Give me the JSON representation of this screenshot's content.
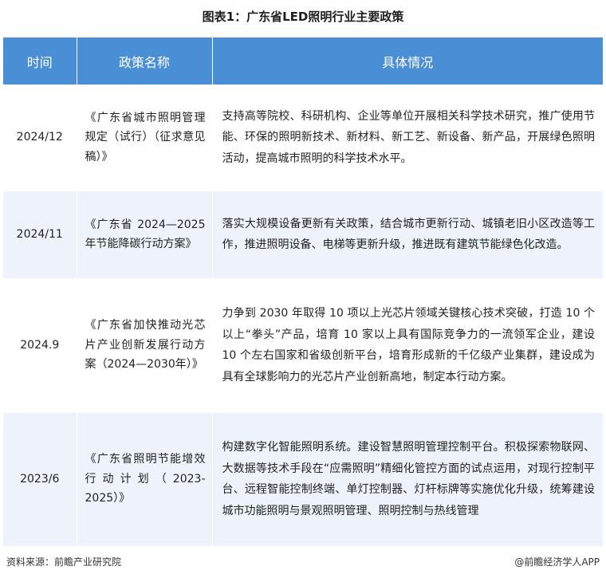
{
  "title": "图表1：广东省LED照明行业主要政策",
  "headers": [
    "时间",
    "政策名称",
    "具体情况"
  ],
  "rows": [
    {
      "time": "2024/12",
      "name": "《广东省城市照明管理规定（试行）（征求意见稿）》",
      "detail": "支持高等院校、科研机构、企业等单位开展相关科学技术研究，推广使用节能、环保的照明新技术、新材料、新工艺、新设备、新产品，开展绿色照明活动，提高城市照明的科学技术水平。"
    },
    {
      "time": "2024/11",
      "name": "《广东省 2024—2025 年节能降碳行动方案》",
      "detail": "落实大规模设备更新有关政策，结合城市更新行动、城镇老旧小区改造等工作，推进照明设备、电梯等更新升级，推进既有建筑节能绿色化改造。"
    },
    {
      "time": "2024.9",
      "name": "《广东省加快推动光芯片产业创新发展行动方案（2024—2030年）》",
      "detail": "力争到 2030 年取得 10 项以上光芯片领域关键核心技术突破，打造 10 个以上“拳头”产品，培育 10 家以上具有国际竞争力的一流领军企业，建设 10 个左右国家和省级创新平台，培育形成新的千亿级产业集群，建设成为具有全球影响力的光芯片产业创新高地，制定本行动方案。"
    },
    {
      "time": "2023/6",
      "name": "《广东省照明节能增效行动计划（2023-2025）》",
      "detail": "构建数字化智能照明系统。建设智慧照明管理控制平台。积极探索物联网、大数据等技术手段在“应需照明”精细化管控方面的试点运用，对现行控制平台、远程智能控制终端、单灯控制器、灯杆标牌等实施优化升级，统筹建设城市功能照明与景观照明管理、照明控制与热线管理"
    }
  ],
  "footer": {
    "source": "资料来源：前瞻产业研究院",
    "brand": "@前瞻经济学人APP"
  },
  "colors": {
    "header_bg": "#4a8fd6",
    "row_alt_bg": "#eef3fb"
  }
}
